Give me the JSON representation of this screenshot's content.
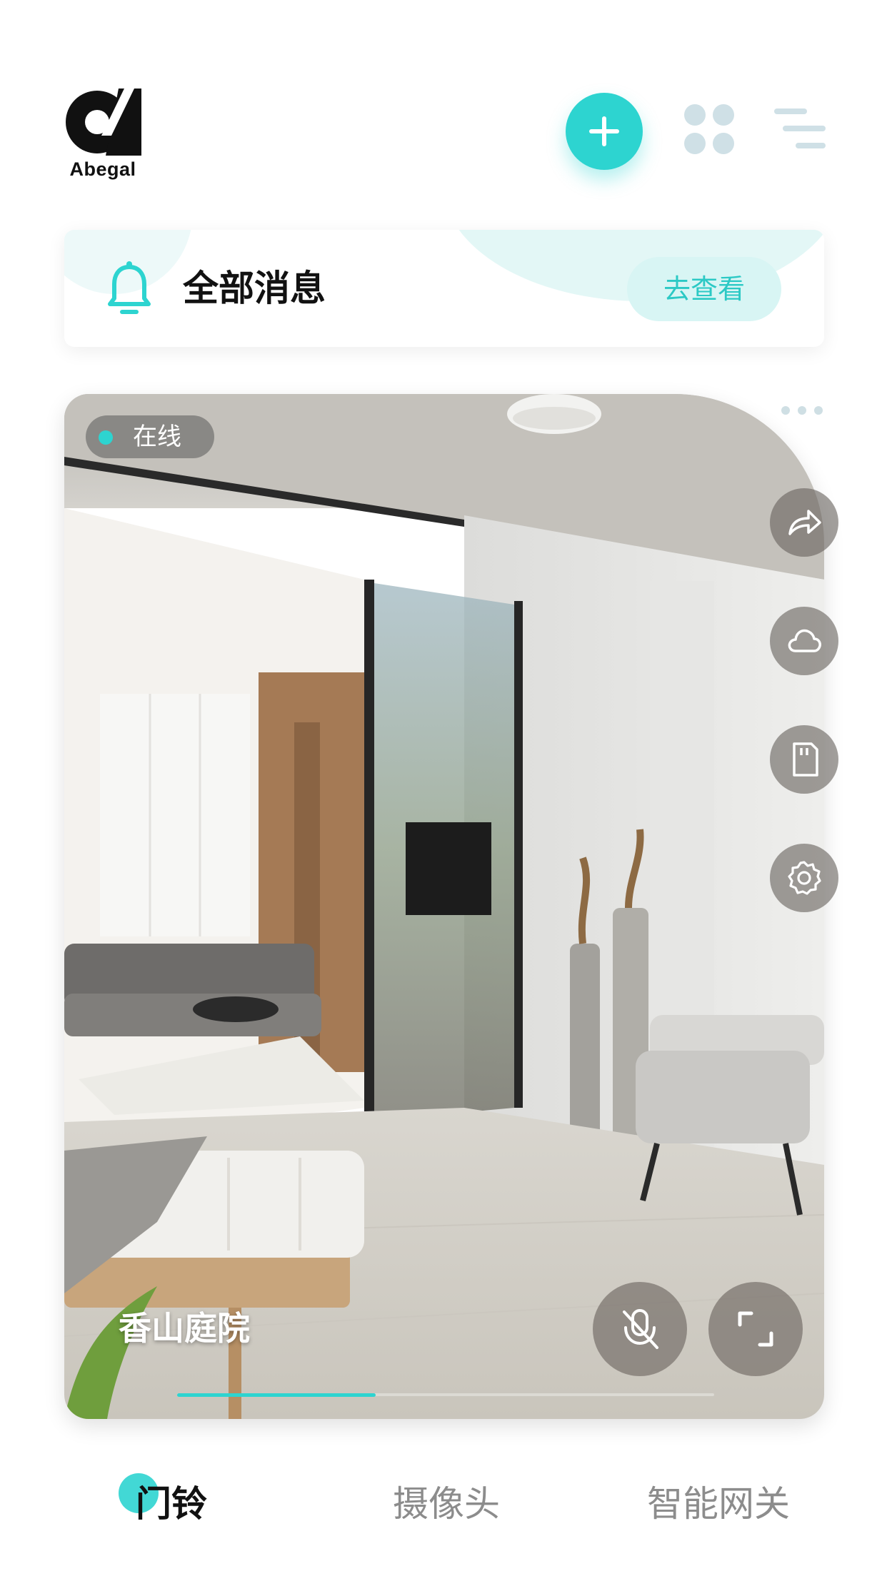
{
  "header": {
    "brand": "Abegal",
    "accent": "#2dd4d0"
  },
  "messages": {
    "title": "全部消息",
    "view_label": "去查看"
  },
  "camera": {
    "status": "在线",
    "name": "香山庭院",
    "progress": 0.37,
    "side_actions": [
      "share-icon",
      "cloud-icon",
      "sd-card-icon",
      "settings-icon"
    ],
    "controls": [
      "mic-off-icon",
      "fullscreen-icon"
    ]
  },
  "tabs": [
    {
      "label": "门铃",
      "active": true
    },
    {
      "label": "摄像头",
      "active": false
    },
    {
      "label": "智能网关",
      "active": false
    }
  ]
}
